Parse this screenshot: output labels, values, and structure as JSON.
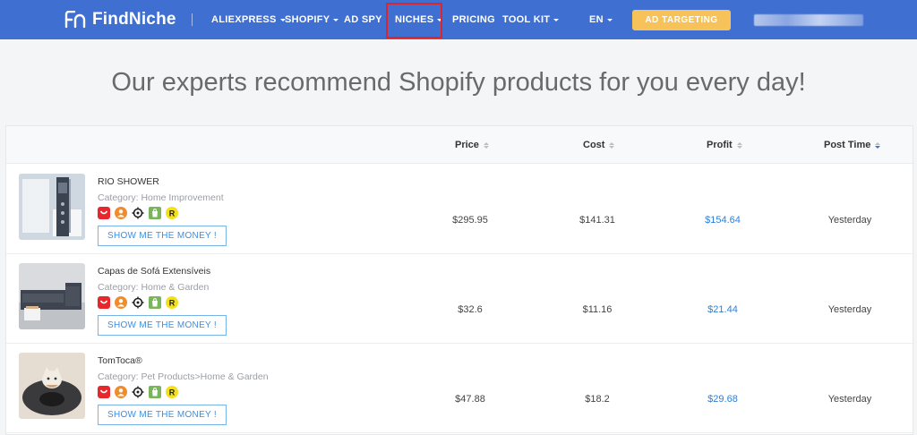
{
  "nav": {
    "logo_text": "FindNiche",
    "items": [
      {
        "label": "ALIEXPRESS",
        "dropdown": true
      },
      {
        "label": "SHOPIFY",
        "dropdown": true
      },
      {
        "label": "AD SPY",
        "dropdown": false
      },
      {
        "label": "NICHES",
        "dropdown": true
      },
      {
        "label": "PRICING",
        "dropdown": false
      },
      {
        "label": "TOOL KIT",
        "dropdown": true
      }
    ],
    "language": "EN",
    "ad_targeting_label": "AD TARGETING",
    "highlighted_item": "NICHES",
    "colors": {
      "bar": "#3f6fd1",
      "accent_button": "#f7c25a",
      "highlight": "#e0242b"
    }
  },
  "headline": "Our experts recommend Shopify products for you every day!",
  "table": {
    "columns": [
      {
        "label": "Price",
        "sort": "none"
      },
      {
        "label": "Cost",
        "sort": "none"
      },
      {
        "label": "Profit",
        "sort": "none"
      },
      {
        "label": "Post Time",
        "sort": "descending"
      }
    ],
    "rows": [
      {
        "name": "RIO SHOWER",
        "category": "Category: Home Improvement",
        "button": "SHOW ME THE MONEY !",
        "price": "$295.95",
        "cost": "$141.31",
        "profit": "$154.64",
        "post_time": "Yesterday",
        "image_icon": "shower-panel-thumbnail"
      },
      {
        "name": "Capas de Sofá Extensíveis",
        "category": "Category: Home & Garden",
        "button": "SHOW ME THE MONEY !",
        "price": "$32.6",
        "cost": "$11.16",
        "profit": "$21.44",
        "post_time": "Yesterday",
        "image_icon": "sofa-thumbnail"
      },
      {
        "name": "TomToca®",
        "category": "Category: Pet Products>Home & Garden",
        "button": "SHOW ME THE MONEY !",
        "price": "$47.88",
        "cost": "$18.2",
        "profit": "$29.68",
        "post_time": "Yesterday",
        "image_icon": "cat-tunnel-thumbnail"
      }
    ],
    "badge_icons": [
      "aliexpress-icon",
      "user-icon",
      "target-icon",
      "shopify-icon",
      "r-icon"
    ],
    "badge_r_letter": "R",
    "colors": {
      "profit": "#2f7fd6",
      "button_border": "#78b3e8"
    }
  }
}
